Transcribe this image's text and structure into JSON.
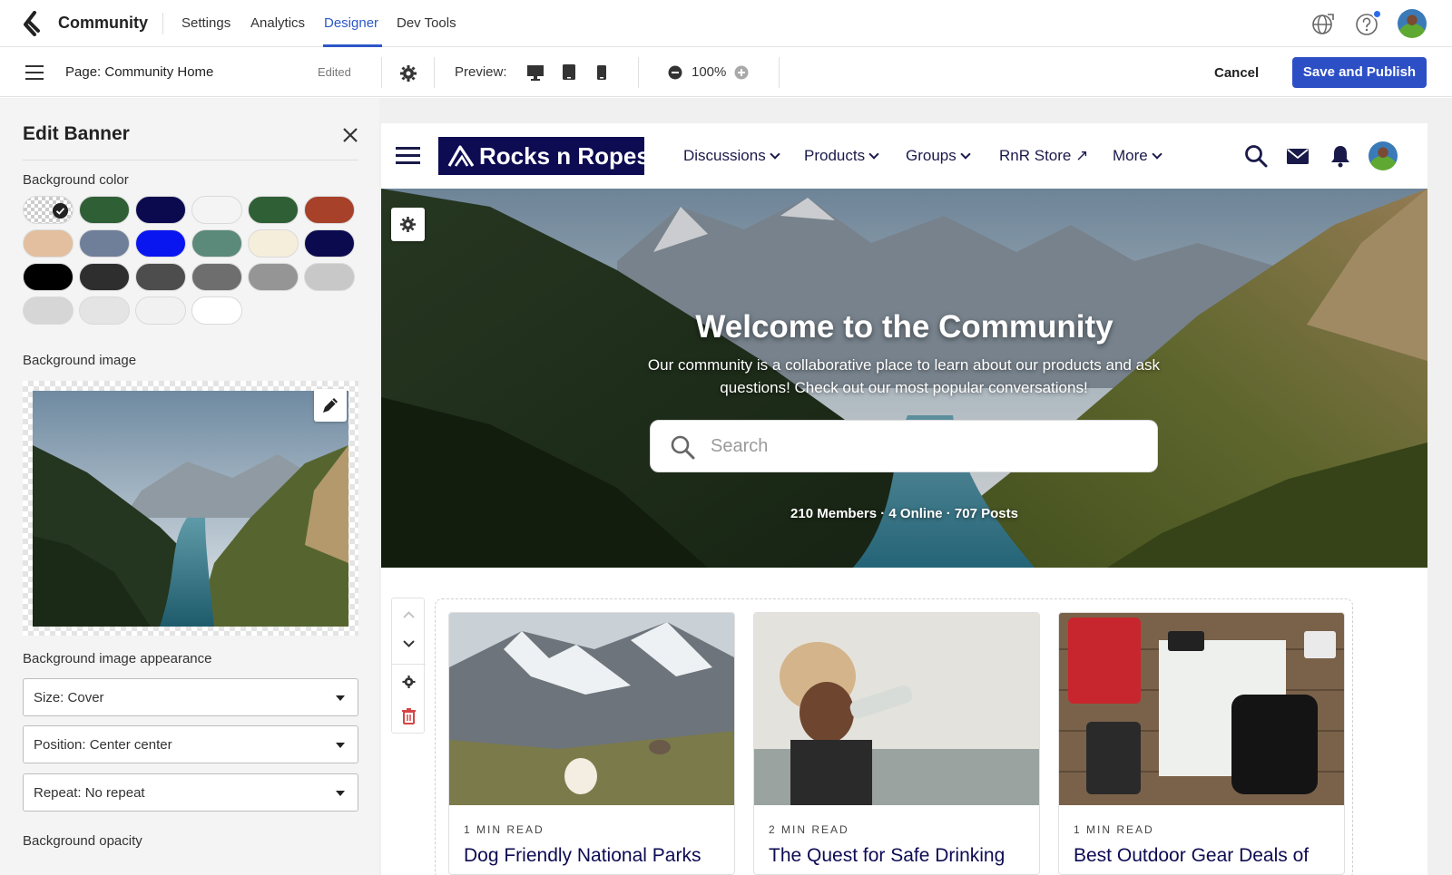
{
  "app": {
    "title": "Community",
    "nav_tabs": [
      {
        "label": "Settings",
        "active": false
      },
      {
        "label": "Analytics",
        "active": false
      },
      {
        "label": "Designer",
        "active": true
      },
      {
        "label": "Dev Tools",
        "active": false
      }
    ],
    "icons": [
      "globe-icon",
      "help-icon",
      "avatar"
    ]
  },
  "toolbar": {
    "page_name": "Page: Community Home",
    "status": "Edited",
    "preview_label": "Preview:",
    "preview_devices": [
      "desktop-icon",
      "tablet-icon",
      "mobile-icon"
    ],
    "zoom": "100%",
    "cancel_label": "Cancel",
    "save_label": "Save and Publish"
  },
  "panel": {
    "title": "Edit Banner",
    "bg_color_label": "Background color",
    "swatches": [
      "transparent",
      "#2f5f34",
      "#0c0a4f",
      "#f4f4f4",
      "#2f5f34",
      "#a8412a",
      "#e3bfa0",
      "#6f7f99",
      "#0a16f0",
      "#5b8a7a",
      "#f5eeda",
      "#0c0a4f",
      "#000000",
      "#2e2e2e",
      "#4d4d4d",
      "#6e6e6e",
      "#959595",
      "#c8c8c8",
      "#d6d6d6",
      "#e4e4e4",
      "#f1f1f1",
      "#ffffff"
    ],
    "selected_swatch": 0,
    "bg_image_label": "Background image",
    "appearance_label": "Background image appearance",
    "size_value": "Size: Cover",
    "position_value": "Position: Center center",
    "repeat_value": "Repeat: No repeat",
    "opacity_label": "Background opacity"
  },
  "site": {
    "brand": "Rocks n Ropes",
    "nav": [
      {
        "label": "Discussions",
        "has_chevron": true
      },
      {
        "label": "Products",
        "has_chevron": true
      },
      {
        "label": "Groups",
        "has_chevron": true
      },
      {
        "label": "RnR Store ↗",
        "has_chevron": false
      },
      {
        "label": "More",
        "has_chevron": true
      }
    ],
    "banner": {
      "title": "Welcome to the Community",
      "subtitle": "Our community is a collaborative place to learn about our products and ask questions! Check out our most popular conversations!",
      "search_placeholder": "Search",
      "stats": "210 Members · 4 Online · 707 Posts"
    },
    "cards": [
      {
        "meta": "1 MIN READ",
        "title": "Dog Friendly National Parks"
      },
      {
        "meta": "2 MIN READ",
        "title": "The Quest for Safe Drinking"
      },
      {
        "meta": "1 MIN READ",
        "title": "Best Outdoor Gear Deals of"
      }
    ]
  },
  "colors": {
    "accent": "#2b57c7",
    "primary_button": "#2d4fc6",
    "brand_navy": "#0d0b52",
    "danger": "#d64545"
  }
}
